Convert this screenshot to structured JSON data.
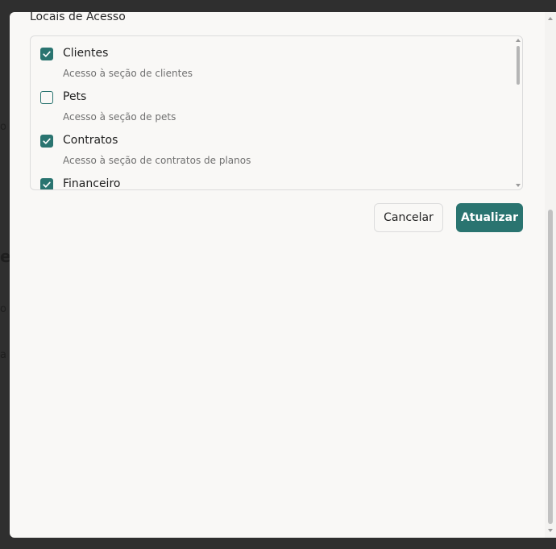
{
  "modal": {
    "section_title": "Locais de Acesso",
    "access_items": [
      {
        "label": "Clientes",
        "description": "Acesso à seção de clientes",
        "checked": true
      },
      {
        "label": "Pets",
        "description": "Acesso à seção de pets",
        "checked": false
      },
      {
        "label": "Contratos",
        "description": "Acesso à seção de contratos de planos",
        "checked": true
      },
      {
        "label": "Financeiro",
        "description": "",
        "checked": true
      }
    ],
    "buttons": {
      "cancel_label": "Cancelar",
      "update_label": "Atualizar"
    }
  },
  "colors": {
    "accent": "#2a7470",
    "modal_background": "#f9f8f6",
    "overlay": "#2f2f2f"
  },
  "icons": {
    "checkbox_checked": "check-icon"
  }
}
